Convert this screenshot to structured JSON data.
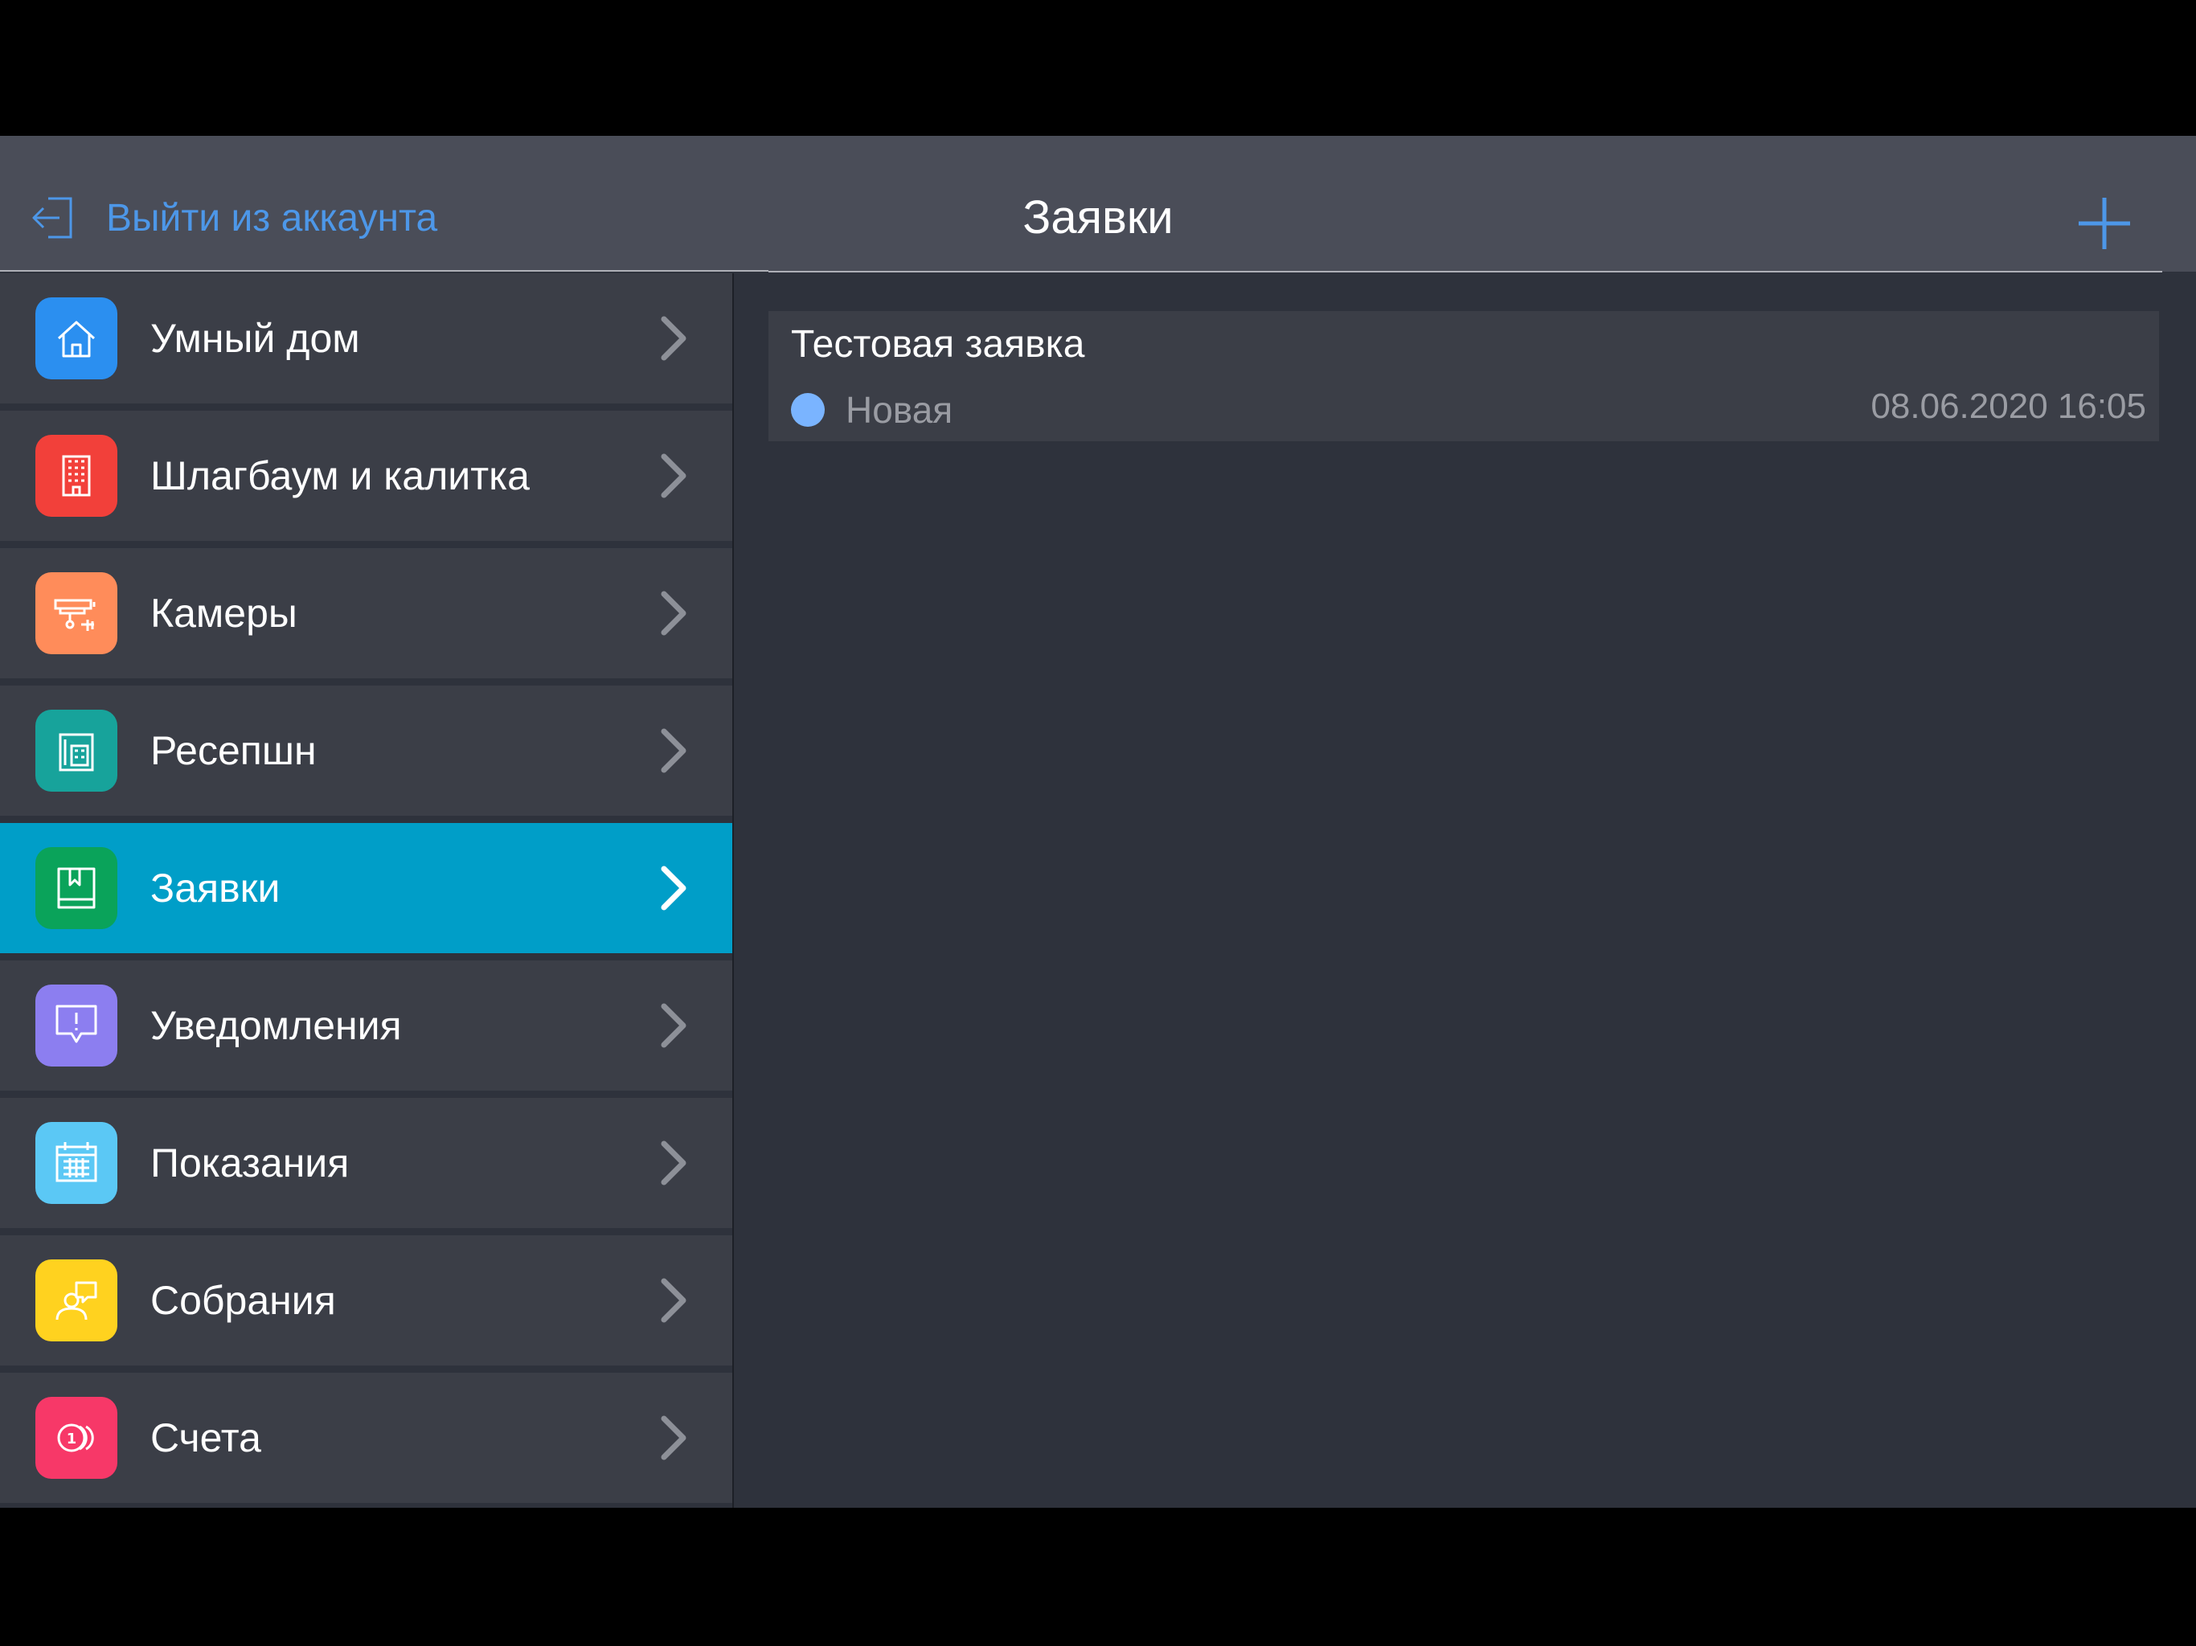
{
  "navbar": {
    "logout_label": "Выйти из аккаунта",
    "title": "Заявки",
    "accent_color": "#4d97e8"
  },
  "sidebar": {
    "items": [
      {
        "label": "Умный дом",
        "icon": "home-icon",
        "color": "#2b8ff0",
        "active": false
      },
      {
        "label": "Шлагбаум и калитка",
        "icon": "building-icon",
        "color": "#f2403a",
        "active": false
      },
      {
        "label": "Камеры",
        "icon": "camera-icon",
        "color": "#ff8c5a",
        "active": false
      },
      {
        "label": "Ресепшн",
        "icon": "reception-phone-icon",
        "color": "#17a39b",
        "active": false
      },
      {
        "label": "Заявки",
        "icon": "book-icon",
        "color": "#0aa35a",
        "active": true
      },
      {
        "label": "Уведомления",
        "icon": "alert-bubble-icon",
        "color": "#8c7ef0",
        "active": false
      },
      {
        "label": "Показания",
        "icon": "calendar-icon",
        "color": "#5bc8f5",
        "active": false
      },
      {
        "label": "Собрания",
        "icon": "meeting-icon",
        "color": "#ffd21f",
        "active": false
      },
      {
        "label": "Счета",
        "icon": "coins-icon",
        "color": "#f73868",
        "active": false
      }
    ],
    "active_color": "#009ec8"
  },
  "requests": [
    {
      "title": "Тестовая заявка",
      "status": "Новая",
      "status_color": "#7ab4ff",
      "date": "08.06.2020 16:05"
    }
  ]
}
